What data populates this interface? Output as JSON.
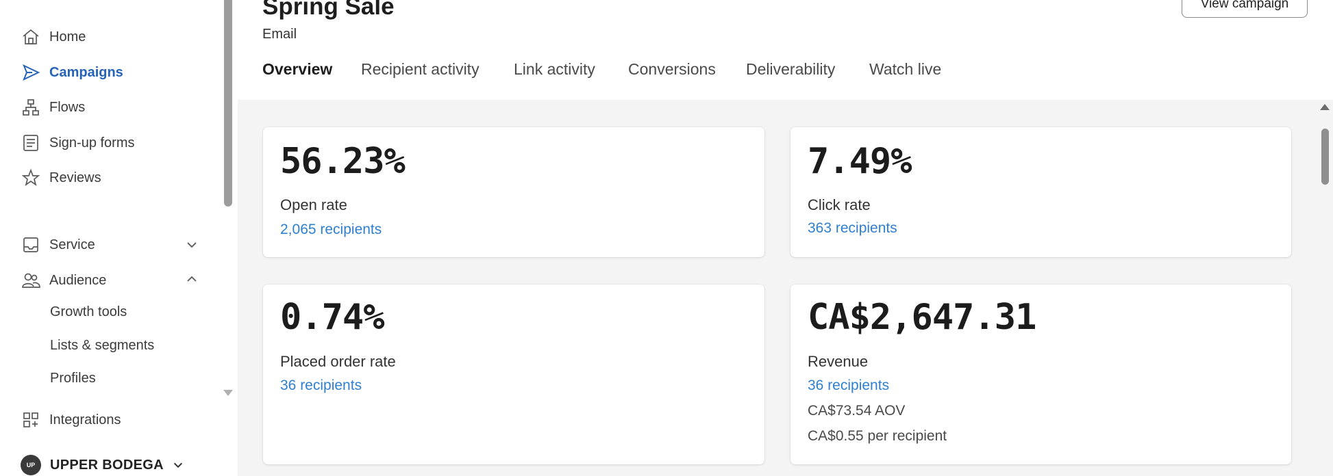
{
  "sidebar": {
    "items": [
      {
        "label": "Home",
        "icon": "home-icon"
      },
      {
        "label": "Campaigns",
        "icon": "send-icon",
        "active": true
      },
      {
        "label": "Flows",
        "icon": "flows-icon"
      },
      {
        "label": "Sign-up forms",
        "icon": "form-icon"
      },
      {
        "label": "Reviews",
        "icon": "star-icon"
      },
      {
        "label": "Service",
        "icon": "inbox-icon",
        "expanded": false
      },
      {
        "label": "Audience",
        "icon": "users-icon",
        "expanded": true
      },
      {
        "label": "Integrations",
        "icon": "integrations-icon"
      }
    ],
    "audience_subitems": [
      "Growth tools",
      "Lists & segments",
      "Profiles"
    ],
    "account": {
      "initials": "UP",
      "name": "UPPER BODEGA"
    }
  },
  "header": {
    "title": "Spring Sale",
    "channel": "Email",
    "view_campaign_label": "View campaign"
  },
  "tabs": [
    {
      "label": "Overview",
      "active": true
    },
    {
      "label": "Recipient activity"
    },
    {
      "label": "Link activity"
    },
    {
      "label": "Conversions"
    },
    {
      "label": "Deliverability"
    },
    {
      "label": "Watch live"
    }
  ],
  "metrics": {
    "open_rate": {
      "value": "56.23%",
      "label": "Open rate",
      "link": "2,065 recipients"
    },
    "click_rate": {
      "value": "7.49%",
      "label": "Click rate",
      "link": "363 recipients"
    },
    "placed_order_rate": {
      "value": "0.74%",
      "label": "Placed order rate",
      "link": "36 recipients"
    },
    "revenue": {
      "value": "CA$2,647.31",
      "label": "Revenue",
      "link": "36 recipients",
      "aov": "CA$73.54 AOV",
      "per_recipient": "CA$0.55 per recipient"
    }
  },
  "colors": {
    "accent": "#2563b8",
    "link": "#2f7fd0",
    "panel_background": "#f4f4f4"
  }
}
